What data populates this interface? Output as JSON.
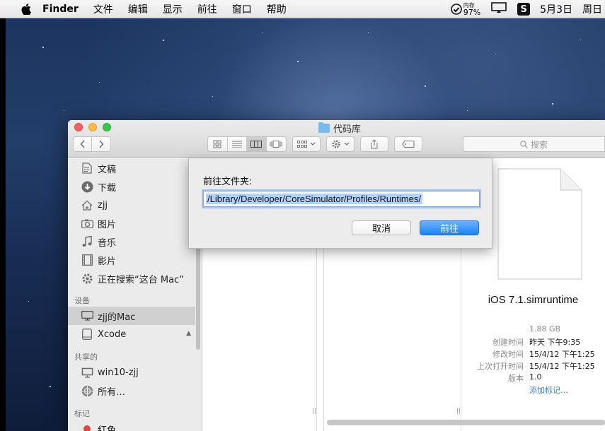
{
  "menubar": {
    "apple_icon": "apple-logo-icon",
    "app_name": "Finder",
    "menus": [
      "文件",
      "编辑",
      "显示",
      "前往",
      "窗口",
      "帮助"
    ],
    "battery": {
      "label": "内存",
      "percent": "97%"
    },
    "date": "5月3日",
    "weekday": "周日"
  },
  "window": {
    "title": "代码库",
    "search_placeholder": "搜索"
  },
  "sidebar": {
    "favorites": [
      {
        "label": "文稿",
        "icon": "document-icon"
      },
      {
        "label": "下载",
        "icon": "download-icon"
      },
      {
        "label": "zjj",
        "icon": "home-icon"
      },
      {
        "label": "图片",
        "icon": "camera-icon"
      },
      {
        "label": "音乐",
        "icon": "music-note-icon"
      },
      {
        "label": "影片",
        "icon": "film-icon"
      },
      {
        "label": "正在搜索“这台 Mac”",
        "icon": "gear-icon"
      }
    ],
    "devices_header": "设备",
    "devices": [
      {
        "label": "zjj的Mac",
        "icon": "computer-icon",
        "selected": true
      },
      {
        "label": "Xcode",
        "icon": "disk-icon",
        "eject": "▲"
      }
    ],
    "shared_header": "共享的",
    "shared": [
      {
        "label": "win10-zjj",
        "icon": "pc-icon"
      },
      {
        "label": "所有…",
        "icon": "network-icon"
      }
    ],
    "tags_header": "标记",
    "tags": [
      {
        "label": "红色",
        "color": "#e2463f"
      }
    ]
  },
  "preview": {
    "file_name": "iOS 7.1.simruntime",
    "size": "1.88 GB",
    "meta": [
      {
        "key": "创建时间",
        "value": "昨天 下午9:35"
      },
      {
        "key": "修改时间",
        "value": "15/4/12 下午1:25"
      },
      {
        "key": "上次打开时间",
        "value": "15/4/12 下午1:25"
      },
      {
        "key": "版本",
        "value": "1.0"
      }
    ],
    "add_tags": "添加标记…"
  },
  "goto_sheet": {
    "label": "前往文件夹:",
    "path": "/Library/Developer/CoreSimulator/Profiles/Runtimes/",
    "cancel": "取消",
    "go": "前往"
  },
  "colors": {
    "accent": "#1a82fb",
    "selection": "#b3d2fb"
  }
}
